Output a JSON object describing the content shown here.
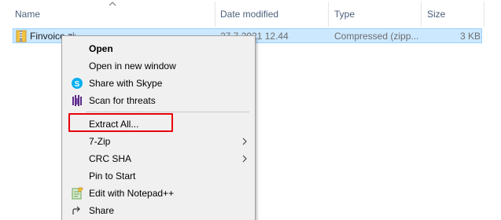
{
  "columns": {
    "name": "Name",
    "date_modified": "Date modified",
    "type": "Type",
    "size": "Size"
  },
  "file": {
    "name": "Finvoice.zip.zip",
    "date_modified": "27.7.2021 12.44",
    "type": "Compressed (zipp...",
    "size": "3 KB"
  },
  "context_menu": {
    "items": [
      {
        "label": "Open",
        "bold": true,
        "icon": ""
      },
      {
        "label": "Open in new window",
        "icon": ""
      },
      {
        "label": "Share with Skype",
        "icon": "skype-icon"
      },
      {
        "label": "Scan for threats",
        "icon": "shield-scan-icon"
      },
      {
        "label": "Extract All...",
        "icon": ""
      },
      {
        "label": "7-Zip",
        "icon": "",
        "submenu": true
      },
      {
        "label": "CRC SHA",
        "icon": "",
        "submenu": true
      },
      {
        "label": "Pin to Start",
        "icon": ""
      },
      {
        "label": "Edit with Notepad++",
        "icon": "notepad-plus-plus-icon"
      },
      {
        "label": "Share",
        "icon": "share-icon"
      }
    ]
  },
  "colors": {
    "selection_bg": "#cce8ff",
    "selection_border": "#99d1ff",
    "highlight_box": "#e8000b",
    "menu_bg": "#f0f0f0",
    "skype_blue": "#00aff0"
  }
}
